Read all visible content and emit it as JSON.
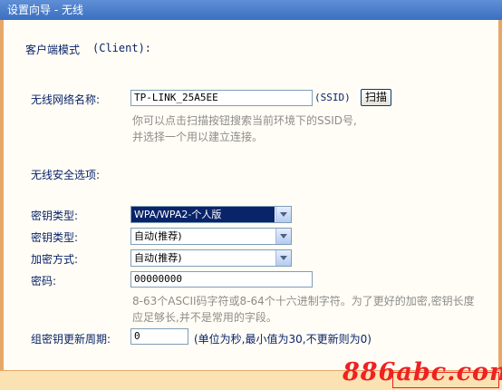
{
  "title": "设置向导 - 无线",
  "mode": {
    "label": "客户端模式",
    "value": "(Client):"
  },
  "ssid": {
    "label": "无线网络名称:",
    "value": "TP-LINK_25A5EE",
    "suffix": "(SSID)",
    "scan_button": "扫描",
    "hint_line1": "你可以点击扫描按钮搜索当前环境下的SSID号,",
    "hint_line2": "并选择一个用以建立连接。"
  },
  "security": {
    "section_label": "无线安全选项:",
    "key_type_label": "密钥类型:",
    "key_type_value": "WPA/WPA2-个人版",
    "key_type2_label": "密钥类型:",
    "key_type2_value": "自动(推荐)",
    "encryption_label": "加密方式:",
    "encryption_value": "自动(推荐)",
    "password_label": "密码:",
    "password_value": "00000000",
    "password_hint_line1": "8-63个ASCII码字符或8-64个十六进制字符。为了更好的加密,密钥长度",
    "password_hint_line2": "应足够长,并不是常用的字段。",
    "renew_label": "组密钥更新周期:",
    "renew_value": "0",
    "renew_hint": "(单位为秒,最小值为30,不更新则为0)"
  },
  "watermark": "886abc.com",
  "colors": {
    "title_bar": "#3a6fc0",
    "frame": "#e6a86a",
    "label": "#0a246a",
    "hint": "#8c8c8c",
    "watermark": "#ee2222"
  }
}
